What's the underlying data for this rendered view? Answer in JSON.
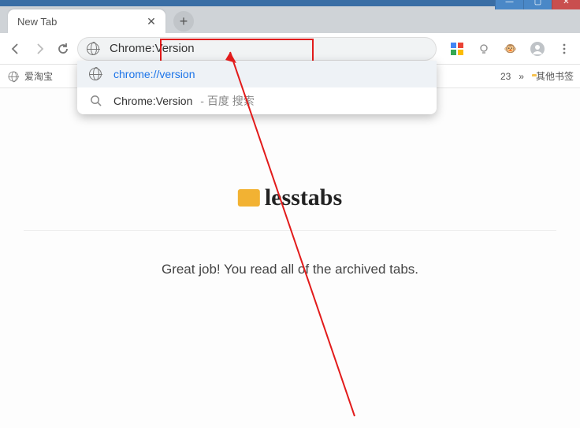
{
  "tab": {
    "title": "New Tab"
  },
  "omnibox": {
    "value": "Chrome:Version",
    "placeholder": ""
  },
  "suggestions": [
    {
      "text": "chrome://version",
      "secondary": "",
      "link": true,
      "icon": "globe"
    },
    {
      "text": "Chrome:Version",
      "secondary": "- 百度 搜索",
      "link": false,
      "icon": "search"
    }
  ],
  "bookmarks": {
    "left_item": "爱淘宝",
    "right_number": "23",
    "other": "其他书签",
    "chevron": "»"
  },
  "page": {
    "logo_text": "lesstabs",
    "message": "Great job! You read all of the archived tabs."
  },
  "window_buttons": {
    "min": "—",
    "max": "▢",
    "close": "✕"
  },
  "newtab_plus": "+"
}
